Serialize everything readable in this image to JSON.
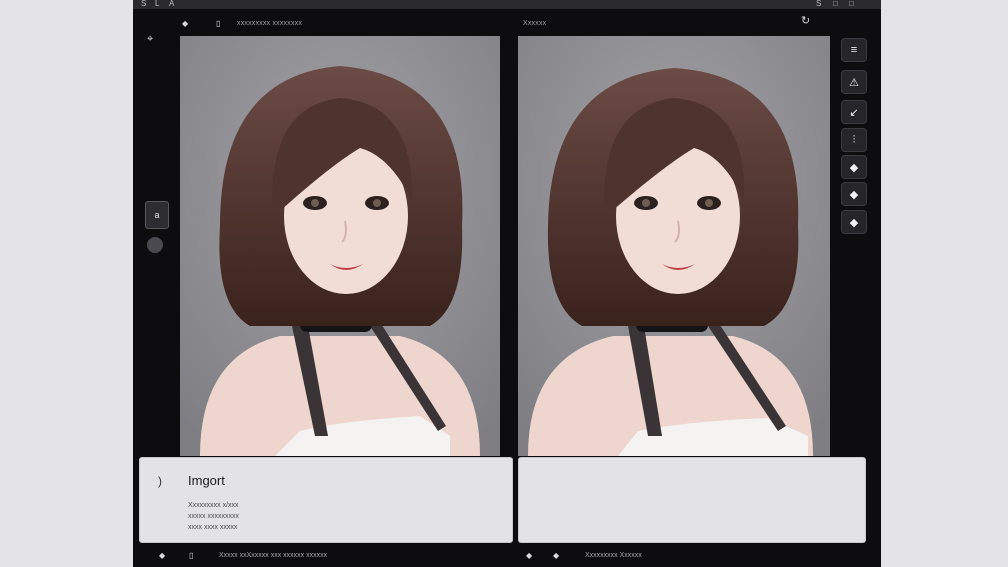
{
  "topstrip": {
    "glyphs": [
      "S",
      "L",
      "A",
      "S",
      "□",
      "□"
    ]
  },
  "toolbar": {
    "left_icon1": "◆",
    "left_icon2": "▯",
    "left_text": "xxxxxxxxx xxxxxxxx",
    "center_text": "Xxxxxx",
    "right_icon": "↻"
  },
  "left_rail": {
    "pin_icon": "⌖",
    "square_button_label": "a"
  },
  "right_tools": {
    "items": [
      "≡",
      "⚠",
      "↙",
      "⫶",
      "◆",
      "◆",
      "◆"
    ]
  },
  "panel_left": {
    "bracket": ")",
    "title": "Imgort",
    "lines": [
      "Xxxxxxxxx x/xxx",
      "xxxxx xxxxxxxxx",
      "xxxx xxxx xxxxx"
    ]
  },
  "bottombar": {
    "left_icon1": "◆",
    "left_icon2": "▯",
    "left_text": "Xxxxx xxXxxxxx xxx xxxxxx xxxxxx",
    "right_icon1": "◆",
    "right_icon2": "◆",
    "right_text": "Xxxxxxxxx Xxxxxx"
  },
  "colors": {
    "app_bg": "#0d0d0f",
    "viewer_bg": "#8d8c91",
    "panel_bg": "#e3e3e6",
    "hair": "#4a2c26",
    "skin": "#efd8d2",
    "lips": "#c23a40",
    "choker": "#141416"
  }
}
